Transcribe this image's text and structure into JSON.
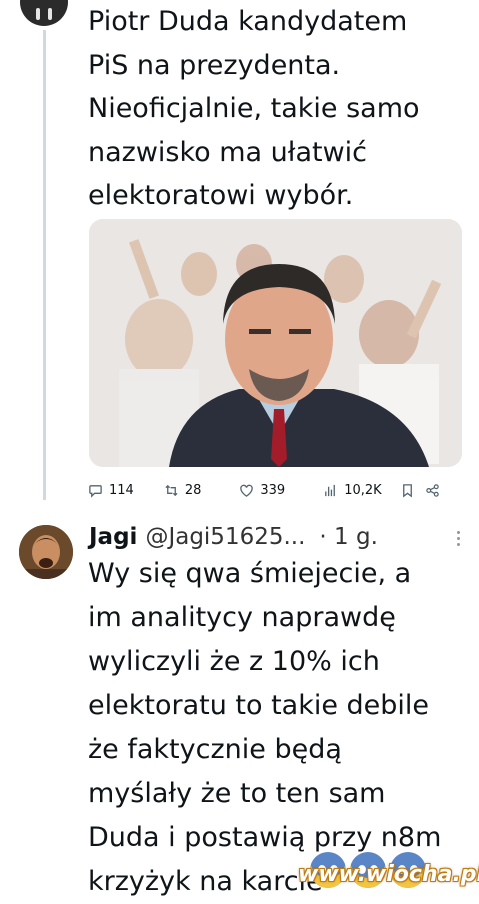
{
  "tweet": {
    "text": "Piotr Duda kandydatem\nPiS na prezydenta.\nNieoficjalnie, takie samo\nnazwisko ma ułatwić\nelektoratowi wybór.",
    "photo_icon": "photo",
    "stats": {
      "replies": "114",
      "retweets": "28",
      "likes": "339",
      "views": "10,2K"
    }
  },
  "reply": {
    "name": "Jagi",
    "handle": "@Jagi51625...",
    "time": "· 1 g.",
    "text": "Wy się qwa śmiejecie, a\nim analitycy naprawdę\nwyliczyli że z 10% ich\nelektoratu to takie debile\nże faktycznie będą\nmyślały że to ten sam\nDuda i postawią przy n8m\nkrzyżyk na karcie"
  },
  "watermark": "www.wiocha.pl",
  "colors": {
    "text": "#0f1419",
    "muted": "#536471",
    "thread_line": "#cfd9de"
  }
}
